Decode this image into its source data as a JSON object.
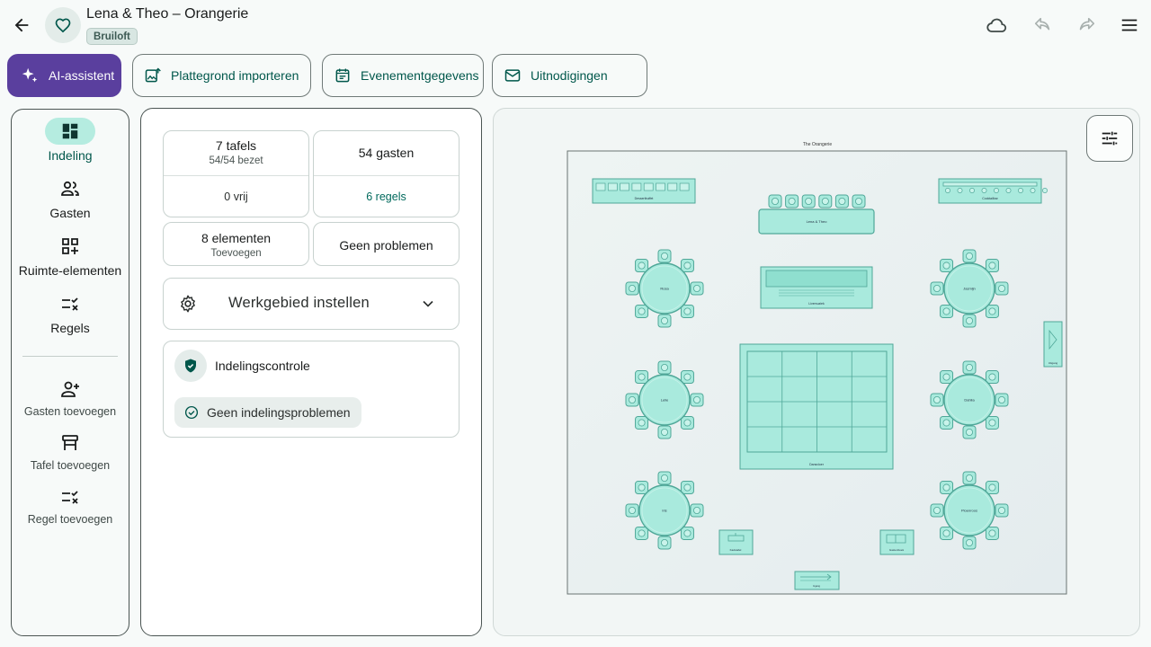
{
  "header": {
    "title": "Lena & Theo – Orangerie",
    "event_type": "Bruiloft"
  },
  "actions": {
    "ai": "AI-assistent",
    "import": "Plattegrond importeren",
    "event": "Evenementgegevens",
    "invites": "Uitnodigingen"
  },
  "nav": {
    "layout": "Indeling",
    "guests": "Gasten",
    "room_elements": "Ruimte-elementen",
    "rules": "Regels",
    "add_guests": "Gasten toevoegen",
    "add_table": "Tafel toevoegen",
    "add_rule": "Regel toevoegen"
  },
  "stats": {
    "tables": "7 tafels",
    "occupancy": "54/54 bezet",
    "free": "0 vrij",
    "guests": "54 gasten",
    "rules": "6 regels",
    "elements": "8 elementen",
    "add": "Toevoegen",
    "problems": "Geen problemen"
  },
  "setup": {
    "label": "Werkgebied instellen"
  },
  "check": {
    "title": "Indelingscontrole",
    "status": "Geen indelingsproblemen"
  },
  "floorplan": {
    "room_name": "The Orangerie",
    "head_table": "Lena & Theo",
    "tables": [
      "Rosa",
      "Jasmijn",
      "Lelie",
      "Dahlia",
      "Iris",
      "Pioenroos"
    ],
    "buffet": "Dessertbuffet",
    "cocktail": "Cocktailbar",
    "stage": "Livemuziek",
    "dancefloor": "Dansvloer",
    "giftbox": "Kadotafel",
    "guestbook": "Gastenboek",
    "entrance": "Ingang",
    "exit": "Uitgang"
  },
  "colors": {
    "primary": "#00574b",
    "ai": "#5a3f9e",
    "table_fill": "#a9eadd",
    "table_stroke": "#4fa798"
  }
}
